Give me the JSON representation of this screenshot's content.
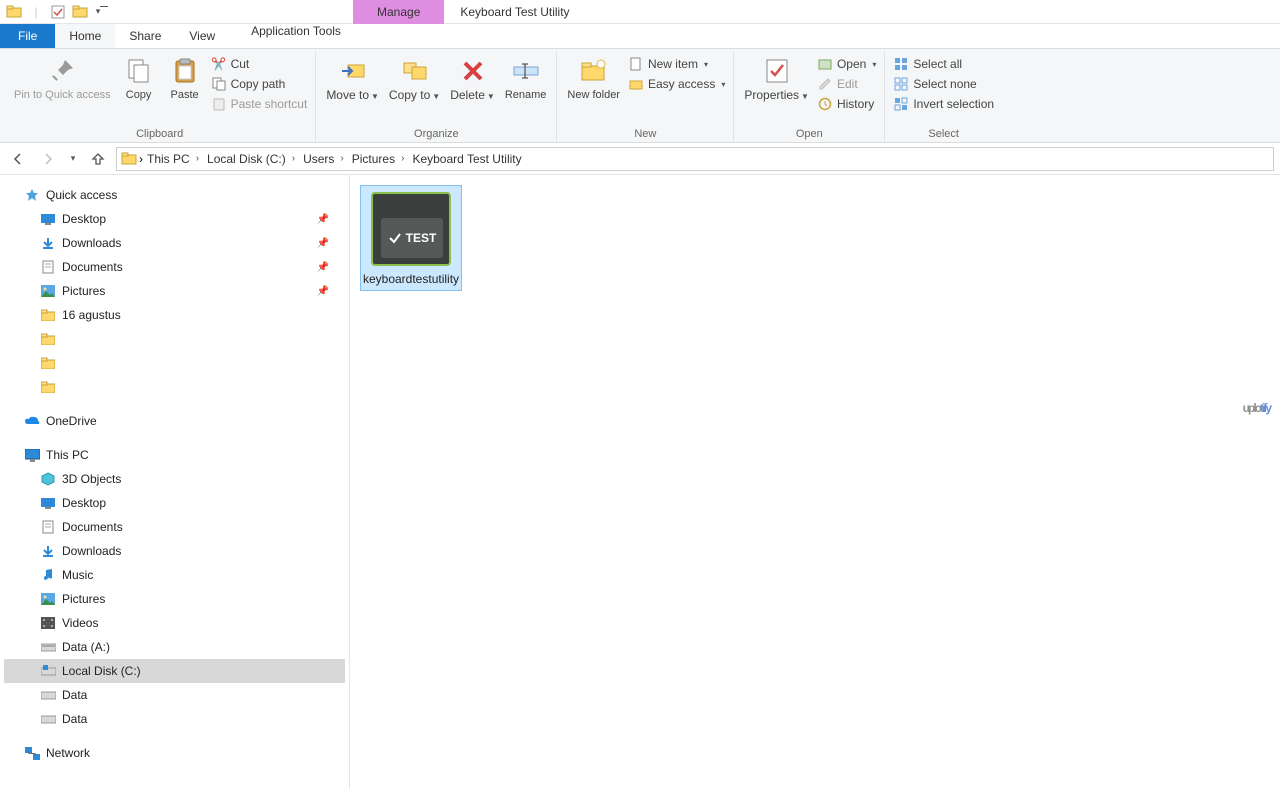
{
  "title": {
    "context_tab": "Manage",
    "window": "Keyboard Test Utility"
  },
  "tabs": {
    "file": "File",
    "home": "Home",
    "share": "Share",
    "view": "View",
    "app_tools": "Application Tools"
  },
  "ribbon": {
    "clipboard": {
      "label": "Clipboard",
      "pin": "Pin to Quick access",
      "copy": "Copy",
      "paste": "Paste",
      "cut": "Cut",
      "copy_path": "Copy path",
      "paste_shortcut": "Paste shortcut"
    },
    "organize": {
      "label": "Organize",
      "move": "Move to",
      "copy": "Copy to",
      "delete": "Delete",
      "rename": "Rename"
    },
    "new_": {
      "label": "New",
      "new_folder": "New folder",
      "new_item": "New item",
      "easy_access": "Easy access"
    },
    "open": {
      "label": "Open",
      "properties": "Properties",
      "open": "Open",
      "edit": "Edit",
      "history": "History"
    },
    "select": {
      "label": "Select",
      "all": "Select all",
      "none": "Select none",
      "invert": "Invert selection"
    }
  },
  "breadcrumb": [
    "This PC",
    "Local Disk (C:)",
    "Users",
    "Pictures",
    "Keyboard Test Utility"
  ],
  "nav": {
    "quick_access": "Quick access",
    "qa": [
      "Desktop",
      "Downloads",
      "Documents",
      "Pictures",
      "16 agustus"
    ],
    "onedrive": "OneDrive",
    "this_pc": "This PC",
    "pc": [
      "3D Objects",
      "Desktop",
      "Documents",
      "Downloads",
      "Music",
      "Pictures",
      "Videos",
      "Data (A:)",
      "Local Disk (C:)",
      "Data",
      "Data"
    ],
    "network": "Network"
  },
  "file": {
    "name": "keyboardtestutility",
    "badge": "TEST"
  },
  "watermark": {
    "a": "uplo",
    "b": "tify"
  }
}
